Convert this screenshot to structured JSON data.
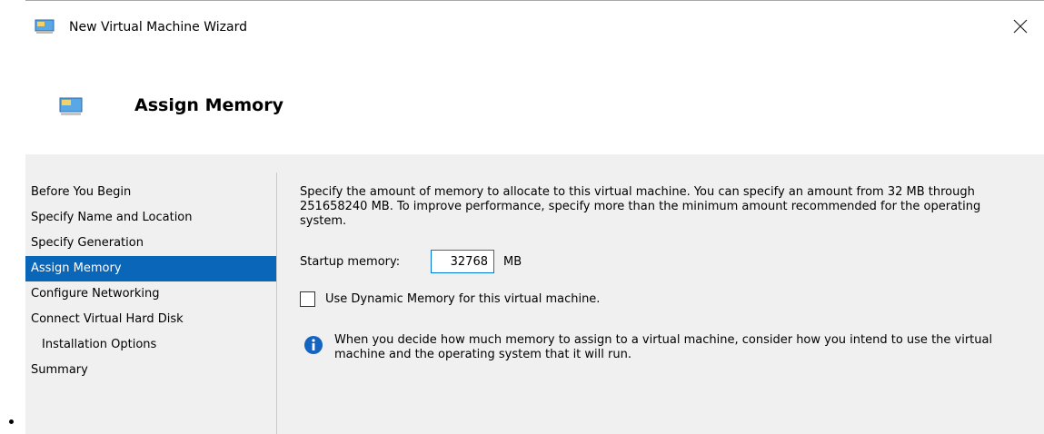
{
  "window": {
    "title": "New Virtual Machine Wizard",
    "close_glyph": "close-icon"
  },
  "header": {
    "title": "Assign Memory",
    "icon": "monitor-icon"
  },
  "sidebar": {
    "items": [
      {
        "label": "Before You Begin",
        "active": false
      },
      {
        "label": "Specify Name and Location",
        "active": false
      },
      {
        "label": "Specify Generation",
        "active": false
      },
      {
        "label": "Assign Memory",
        "active": true
      },
      {
        "label": "Configure Networking",
        "active": false
      },
      {
        "label": "Connect Virtual Hard Disk",
        "active": false
      },
      {
        "label": "Installation Options",
        "active": false,
        "sub": true
      },
      {
        "label": "Summary",
        "active": false
      }
    ]
  },
  "main": {
    "description": "Specify the amount of memory to allocate to this virtual machine. You can specify an amount from 32 MB through 251658240 MB. To improve performance, specify more than the minimum amount recommended for the operating system.",
    "startup_memory_label": "Startup memory:",
    "startup_memory_value": "32768",
    "startup_memory_unit": "MB",
    "dynamic_memory_label": "Use Dynamic Memory for this virtual machine.",
    "dynamic_memory_checked": false,
    "info_text": "When you decide how much memory to assign to a virtual machine, consider how you intend to use the virtual machine and the operating system that it will run."
  },
  "colors": {
    "accent": "#0a66b8",
    "panel_bg": "#f0f0f0",
    "info_icon": "#1565c0"
  }
}
